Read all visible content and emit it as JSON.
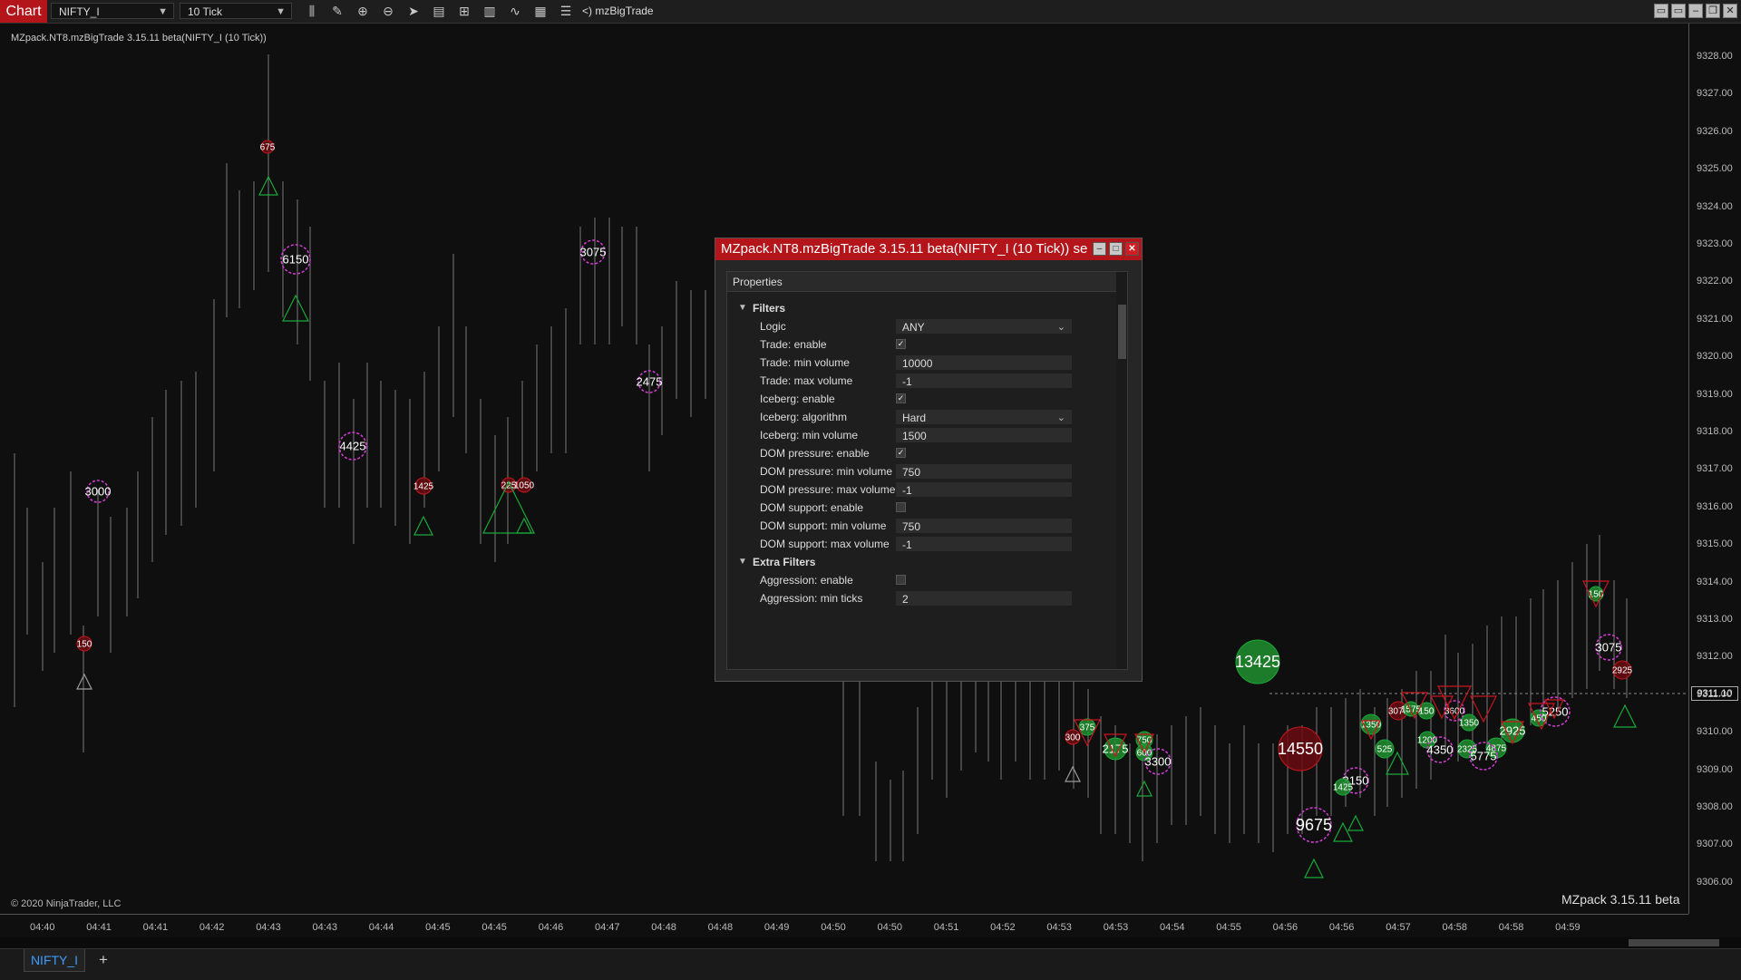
{
  "toolbar": {
    "chart_label": "Chart",
    "instrument": "NIFTY_I",
    "interval": "10 Tick",
    "indicator": "mzBigTrade",
    "indicator_prefix": "<)",
    "icons": [
      "bar-type-icon",
      "draw-tool-icon",
      "zoom-in-icon",
      "zoom-out-icon",
      "pointer-icon",
      "data-box-icon",
      "chart-trader-icon",
      "instrument-icon",
      "indicators-icon",
      "strategies-icon",
      "properties-icon"
    ]
  },
  "chart": {
    "title": "MZpack.NT8.mzBigTrade 3.15.11 beta(NIFTY_I (10 Tick))",
    "copyright": "© 2020 NinjaTrader, LLC",
    "brand": "MZpack 3.15.11 beta",
    "current_price": "9311.10",
    "price_labels": [
      "9328.00",
      "9327.00",
      "9326.00",
      "9325.00",
      "9324.00",
      "9323.00",
      "9322.00",
      "9321.00",
      "9320.00",
      "9319.00",
      "9318.00",
      "9317.00",
      "9316.00",
      "9315.00",
      "9314.00",
      "9313.00",
      "9312.00",
      "9311.00",
      "9310.00",
      "9309.00",
      "9308.00",
      "9307.00",
      "9306.00"
    ],
    "time_labels": [
      "04:40",
      "04:41",
      "04:41",
      "04:42",
      "04:43",
      "04:43",
      "04:44",
      "04:45",
      "04:45",
      "04:46",
      "04:47",
      "04:48",
      "04:48",
      "04:49",
      "04:50",
      "04:50",
      "04:51",
      "04:52",
      "04:53",
      "04:53",
      "04:54",
      "04:55",
      "04:56",
      "04:56",
      "04:57",
      "04:58",
      "04:58",
      "04:59"
    ],
    "trade_markers": [
      {
        "label": "675"
      },
      {
        "label": "6150"
      },
      {
        "label": "3075"
      },
      {
        "label": "2475"
      },
      {
        "label": "4425"
      },
      {
        "label": "3000"
      },
      {
        "label": "1425"
      },
      {
        "label": "225"
      },
      {
        "label": "1050"
      },
      {
        "label": "150"
      },
      {
        "label": "13425"
      },
      {
        "label": "14550"
      },
      {
        "label": "9675"
      },
      {
        "label": "375"
      },
      {
        "label": "300"
      },
      {
        "label": "2175"
      },
      {
        "label": "750"
      },
      {
        "label": "600"
      },
      {
        "label": "3300"
      },
      {
        "label": "3150"
      },
      {
        "label": "1425"
      },
      {
        "label": "1350"
      },
      {
        "label": "525"
      },
      {
        "label": "3075"
      },
      {
        "label": "150"
      },
      {
        "label": "3600"
      },
      {
        "label": "1200"
      },
      {
        "label": "4350"
      },
      {
        "label": "1350"
      },
      {
        "label": "2325"
      },
      {
        "label": "4875"
      },
      {
        "label": "5775"
      },
      {
        "label": "2925"
      },
      {
        "label": "450"
      },
      {
        "label": "5250"
      },
      {
        "label": "150"
      },
      {
        "label": "3075"
      },
      {
        "label": "2925"
      },
      {
        "label": "1575"
      }
    ]
  },
  "dialog": {
    "title": "MZpack.NT8.mzBigTrade 3.15.11 beta(NIFTY_I (10 Tick)) se",
    "properties_header": "Properties",
    "categories": [
      {
        "name": "Filters",
        "expanded": true
      },
      {
        "name": "Extra Filters",
        "expanded": true
      }
    ],
    "rows": [
      {
        "name": "Logic",
        "type": "select",
        "value": "ANY"
      },
      {
        "name": "Trade: enable",
        "type": "check",
        "checked": true
      },
      {
        "name": "Trade: min volume",
        "type": "text",
        "value": "10000"
      },
      {
        "name": "Trade: max volume",
        "type": "text",
        "value": "-1"
      },
      {
        "name": "Iceberg: enable",
        "type": "check",
        "checked": true
      },
      {
        "name": "Iceberg: algorithm",
        "type": "select",
        "value": "Hard"
      },
      {
        "name": "Iceberg: min volume",
        "type": "text",
        "value": "1500"
      },
      {
        "name": "DOM pressure: enable",
        "type": "check",
        "checked": true
      },
      {
        "name": "DOM pressure: min volume",
        "type": "text",
        "value": "750"
      },
      {
        "name": "DOM pressure: max volume",
        "type": "text",
        "value": "-1"
      },
      {
        "name": "DOM support: enable",
        "type": "check",
        "checked": false
      },
      {
        "name": "DOM support: min volume",
        "type": "text",
        "value": "750"
      },
      {
        "name": "DOM support: max volume",
        "type": "text",
        "value": "-1"
      },
      {
        "name": "Aggression: enable",
        "type": "check",
        "checked": false
      },
      {
        "name": "Aggression: min ticks",
        "type": "text",
        "value": "2"
      }
    ]
  },
  "tabs": [
    {
      "label": "NIFTY_I",
      "active": true
    }
  ],
  "colors": {
    "accent": "#b3151a",
    "buy": "#1aa83a",
    "sell": "#c8161d",
    "iceberg": "#d63cd6",
    "tab_text": "#3a9eff"
  }
}
